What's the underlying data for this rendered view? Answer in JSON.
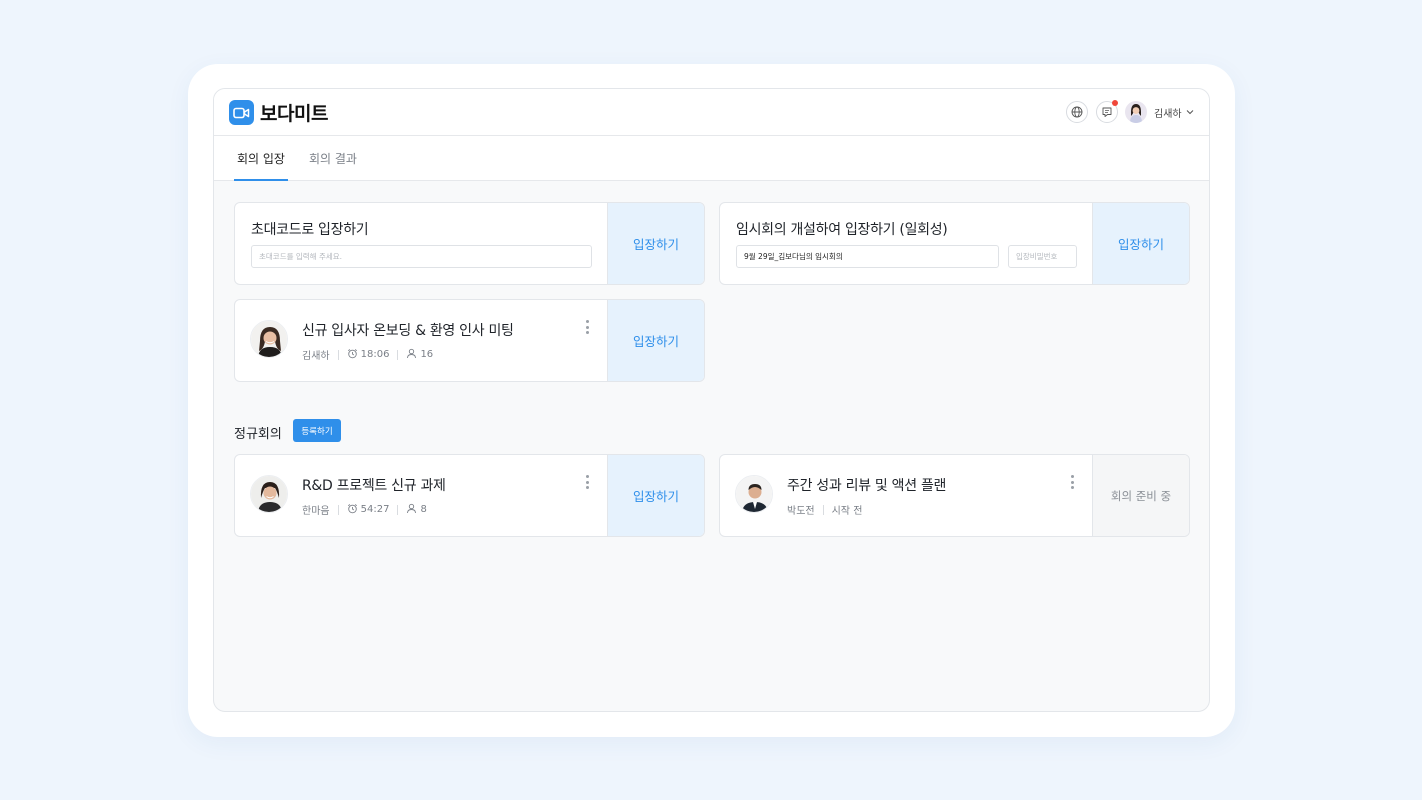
{
  "app": {
    "name": "보다미트"
  },
  "header": {
    "user_name": "김새하"
  },
  "tabs": [
    {
      "label": "회의 입장"
    },
    {
      "label": "회의 결과"
    }
  ],
  "join_code": {
    "title": "초대코드로 입장하기",
    "placeholder": "초대코드를 입력해 주세요.",
    "button": "입장하기"
  },
  "instant": {
    "title": "임시회의 개설하여 입장하기 (일회성)",
    "name_value": "9월 29일_김보다님의 임시회의",
    "password_placeholder": "입장비밀번호",
    "button": "입장하기"
  },
  "meetings": [
    {
      "title": "신규 입사자 온보딩 & 환영 인사 미팅",
      "host": "김새하",
      "time": "18:06",
      "participants": "16",
      "button": "입장하기"
    }
  ],
  "regular": {
    "title": "정규회의",
    "register_button": "등록하기",
    "items": [
      {
        "title": "R&D 프로젝트 신규 과제",
        "host": "한마음",
        "time": "54:27",
        "participants": "8",
        "button": "입장하기"
      },
      {
        "title": "주간 성과 리뷰 및 액션 플랜",
        "host": "박도전",
        "status": "시작 전",
        "button": "회의 준비 중"
      }
    ]
  },
  "colors": {
    "accent": "#2f8fea",
    "accent_light": "#e6f2fd",
    "notification": "#f0473a"
  }
}
